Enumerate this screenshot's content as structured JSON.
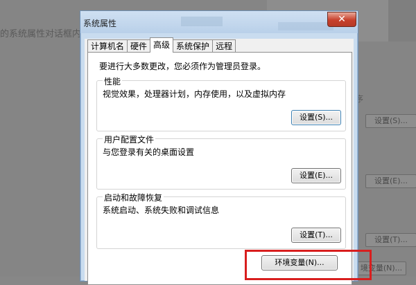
{
  "background": {
    "left_text": "的系统属性对话框内",
    "right_text": "序",
    "buttons": [
      "设置(S)...",
      "设置(E)...",
      "设置(T)...",
      "境变量(N)..."
    ]
  },
  "dialog": {
    "title": "系统属性",
    "close_glyph": "✕",
    "tabs": [
      "计算机名",
      "硬件",
      "高级",
      "系统保护",
      "远程"
    ],
    "active_tab": "高级",
    "admin_note": "要进行大多数更改，您必须作为管理员登录。",
    "groups": [
      {
        "title": "性能",
        "desc": "视觉效果，处理器计划，内存使用，以及虚拟内存",
        "button": "设置(S)..."
      },
      {
        "title": "用户配置文件",
        "desc": "与您登录有关的桌面设置",
        "button": "设置(E)..."
      },
      {
        "title": "启动和故障恢复",
        "desc": "系统启动、系统失败和调试信息",
        "button": "设置(T)..."
      }
    ],
    "env_button": "环境变量(N)...",
    "highlight_color": "#d81e1e"
  }
}
